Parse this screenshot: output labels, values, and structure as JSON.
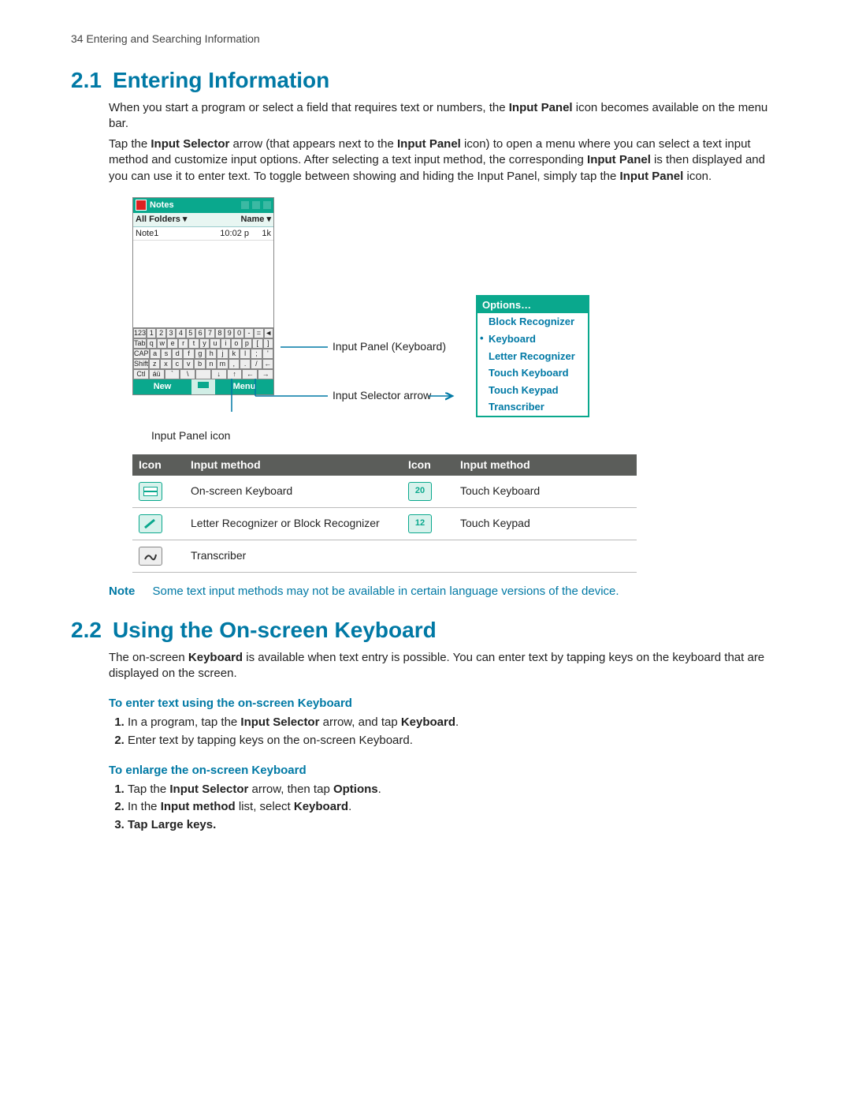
{
  "page_header": "34  Entering and Searching Information",
  "s21": {
    "num": "2.1",
    "title": "Entering Information",
    "p1a": "When you start a program or select a field that requires text or numbers, the ",
    "p1b": "Input Panel",
    "p1c": " icon  becomes available on the menu bar.",
    "p2a": "Tap the ",
    "p2b": "Input Selector",
    "p2c": " arrow (that appears next to the ",
    "p2d": "Input Panel",
    "p2e": " icon) to open a menu where you can select a text input method and customize input options. After selecting a text input method, the corresponding ",
    "p2f": "Input Panel",
    "p2g": " is then displayed and you can use it to enter text. To toggle between showing and hiding the Input Panel, simply tap the ",
    "p2h": "Input Panel",
    "p2i": " icon."
  },
  "phone": {
    "title": "Notes",
    "folders": "All Folders ▾",
    "name": "Name ▾",
    "note": "Note1",
    "time": "10:02 p",
    "size": "1k",
    "kbd": {
      "r1": [
        "123",
        "1",
        "2",
        "3",
        "4",
        "5",
        "6",
        "7",
        "8",
        "9",
        "0",
        "-",
        "=",
        "◄"
      ],
      "r2": [
        "Tab",
        "q",
        "w",
        "e",
        "r",
        "t",
        "y",
        "u",
        "i",
        "o",
        "p",
        "[",
        "]"
      ],
      "r3": [
        "CAP",
        "a",
        "s",
        "d",
        "f",
        "g",
        "h",
        "j",
        "k",
        "l",
        ";",
        "'"
      ],
      "r4": [
        "Shift",
        "z",
        "x",
        "c",
        "v",
        "b",
        "n",
        "m",
        ",",
        ".",
        "/",
        "←"
      ],
      "r5": [
        "Ctl",
        "áü",
        "`",
        "\\",
        " ",
        "↓",
        "↑",
        "←",
        "→"
      ]
    },
    "new": "New",
    "menu": "Menu"
  },
  "conn": {
    "l1": "Input Panel (Keyboard)",
    "l2": "Input Selector arrow",
    "l3": "Input Panel icon"
  },
  "optmenu": {
    "hdr": "Options…",
    "items": [
      "Block Recognizer",
      "Keyboard",
      "Letter Recognizer",
      "Touch Keyboard",
      "Touch Keypad",
      "Transcriber"
    ],
    "selected": 1
  },
  "tbl": {
    "h_icon": "Icon",
    "h_method": "Input method",
    "r1": "On-screen Keyboard",
    "r2": "Letter Recognizer or Block Recognizer",
    "r3": "Transcriber",
    "r4": "Touch Keyboard",
    "r5": "Touch Keypad",
    "ic4": "20",
    "ic5": "12"
  },
  "note": {
    "label": "Note",
    "text": "Some text input methods may not be available in certain language versions of the device."
  },
  "s22": {
    "num": "2.2",
    "title": "Using the On-screen Keyboard",
    "p1a": "The on-screen ",
    "p1b": "Keyboard",
    "p1c": " is available when text entry is possible. You can enter text by tapping keys on the keyboard that are displayed on the screen.",
    "h1": "To enter text using the on-screen Keyboard",
    "s1a": "In a program, tap the ",
    "s1b": "Input Selector",
    "s1c": " arrow, and tap ",
    "s1d": "Keyboard",
    "s1e": ".",
    "s2": "Enter text by tapping keys on the on-screen Keyboard.",
    "h2": "To enlarge the on-screen Keyboard",
    "e1a": "Tap the ",
    "e1b": "Input Selector",
    "e1c": " arrow, then tap ",
    "e1d": "Options",
    "e1e": ".",
    "e2a": "In the ",
    "e2b": "Input method",
    "e2c": " list, select ",
    "e2d": "Keyboard",
    "e2e": ".",
    "e3a": "Tap ",
    "e3b": "Large keys",
    "e3c": "."
  }
}
